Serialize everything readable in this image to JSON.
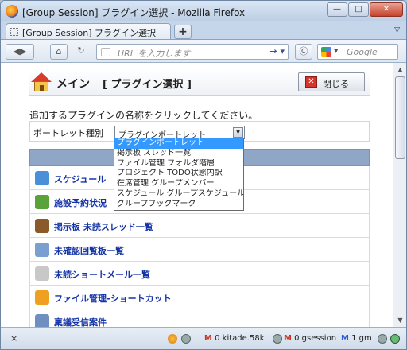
{
  "browser": {
    "window_title": "[Group Session] プラグイン選択 - Mozilla Firefox",
    "tab_label": "[Group Session] プラグイン選択",
    "newtab_label": "+",
    "url_placeholder": "URL を入力します",
    "search_placeholder": "Google",
    "status": {
      "close_label": "×",
      "items": [
        {
          "label": "0 kitade.58k"
        },
        {
          "label": "0 gsession"
        },
        {
          "label": "1 gm"
        }
      ]
    }
  },
  "header": {
    "title": "メイン",
    "subtitle": "[ プラグイン選択 ]",
    "close_button": "閉じる"
  },
  "instruction": "追加するプラグインの名称をクリックしてください。",
  "portlet": {
    "label": "ポートレット種別",
    "selected": "プラグインポートレット",
    "options": [
      "プラグインポートレット",
      "掲示板 スレッド一覧",
      "ファイル管理 フォルダ階層",
      "プロジェクト TODO状態内訳",
      "在席管理 グループメンバー",
      "スケジュール グループスケジュール",
      "グループブックマーク"
    ]
  },
  "plugins": [
    {
      "label": "スケジュール",
      "icon": "schedule-icon",
      "color": "#4a90d9"
    },
    {
      "label": "施設予約状況",
      "icon": "facility-icon",
      "color": "#5aa33a"
    },
    {
      "label": "掲示板 未読スレッド一覧",
      "icon": "bulletin-icon",
      "color": "#8a5a2b"
    },
    {
      "label": "未確認回覧板一覧",
      "icon": "circular-icon",
      "color": "#7aa0d0"
    },
    {
      "label": "未読ショートメール一覧",
      "icon": "shortmail-icon",
      "color": "#c8c8c8"
    },
    {
      "label": "ファイル管理-ショートカット",
      "icon": "folder-icon",
      "color": "#f0a020"
    },
    {
      "label": "稟議受信案件",
      "icon": "approval-icon",
      "color": "#6f8fc0"
    }
  ]
}
